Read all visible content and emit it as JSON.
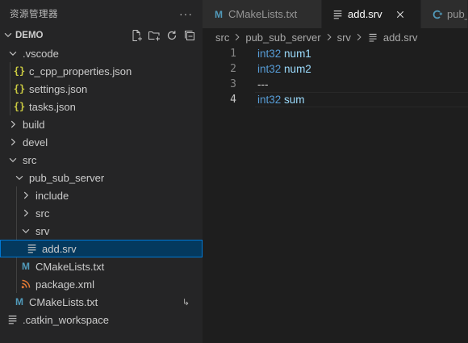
{
  "sidebar": {
    "title": "资源管理器",
    "more_icon": "ellipsis-icon",
    "folder": {
      "name": "DEMO",
      "actions": [
        "new-file-icon",
        "new-folder-icon",
        "refresh-icon",
        "collapse-all-icon"
      ]
    },
    "tree": [
      {
        "label": ".vscode",
        "depth": 1,
        "kind": "folder-open"
      },
      {
        "label": "c_cpp_properties.json",
        "depth": 2,
        "kind": "json"
      },
      {
        "label": "settings.json",
        "depth": 2,
        "kind": "json"
      },
      {
        "label": "tasks.json",
        "depth": 2,
        "kind": "json"
      },
      {
        "label": "build",
        "depth": 1,
        "kind": "folder-closed"
      },
      {
        "label": "devel",
        "depth": 1,
        "kind": "folder-closed"
      },
      {
        "label": "src",
        "depth": 1,
        "kind": "folder-open"
      },
      {
        "label": "pub_sub_server",
        "depth": 2,
        "kind": "folder-open"
      },
      {
        "label": "include",
        "depth": 3,
        "kind": "folder-closed"
      },
      {
        "label": "src",
        "depth": 3,
        "kind": "folder-closed"
      },
      {
        "label": "srv",
        "depth": 3,
        "kind": "folder-open"
      },
      {
        "label": "add.srv",
        "depth": 4,
        "kind": "lines",
        "selected": true
      },
      {
        "label": "CMakeLists.txt",
        "depth": 3,
        "kind": "cmake"
      },
      {
        "label": "package.xml",
        "depth": 3,
        "kind": "rss"
      },
      {
        "label": "CMakeLists.txt",
        "depth": 2,
        "kind": "cmake",
        "badge": "↳"
      },
      {
        "label": ".catkin_workspace",
        "depth": 1,
        "kind": "lines"
      }
    ]
  },
  "tabs": [
    {
      "label": "CMakeLists.txt",
      "icon": "cmake-icon",
      "active": false
    },
    {
      "label": "add.srv",
      "icon": "lines-icon",
      "active": true,
      "close_icon": "close-icon"
    },
    {
      "label": "pub_",
      "icon": "cpp-icon",
      "active": false
    }
  ],
  "breadcrumb": [
    "src",
    "pub_sub_server",
    "srv",
    "add.srv"
  ],
  "code": {
    "lines": [
      {
        "number": "1",
        "type": "int32",
        "name": "num1"
      },
      {
        "number": "2",
        "type": "int32",
        "name": "num2"
      },
      {
        "number": "3",
        "plain": "---"
      },
      {
        "number": "4",
        "type": "int32",
        "name": "sum",
        "current": true
      }
    ]
  },
  "colors": {
    "sidebar_bg": "#252526",
    "editor_bg": "#1e1e1e",
    "selection_bg": "#04395e",
    "focus_border": "#0078d4",
    "keyword": "#569cd6",
    "identifier": "#9cdcfe",
    "json_icon": "#cbcb41",
    "cmake_icon": "#519aba",
    "xml_icon": "#e37933"
  }
}
